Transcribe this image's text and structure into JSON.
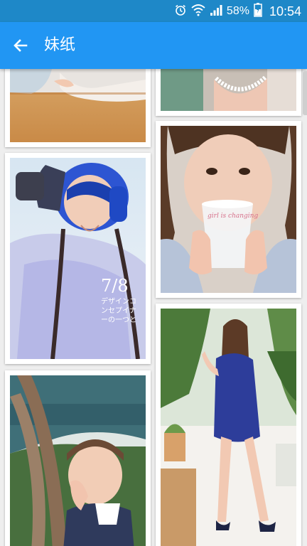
{
  "status_bar": {
    "battery_percent": "58%",
    "time": "10:54",
    "icons": [
      "alarm-icon",
      "wifi-icon",
      "signal-icon",
      "battery-charging-icon"
    ]
  },
  "app_bar": {
    "title": "妹纸",
    "back_icon": "arrow-left-icon",
    "background": "#2196f3"
  },
  "photos": {
    "magazine_cover": {
      "number": "7/8",
      "lines": [
        "デザインコ",
        "ンセプイナ",
        "ーの一つと"
      ]
    },
    "cup_text": "girl is changing"
  }
}
